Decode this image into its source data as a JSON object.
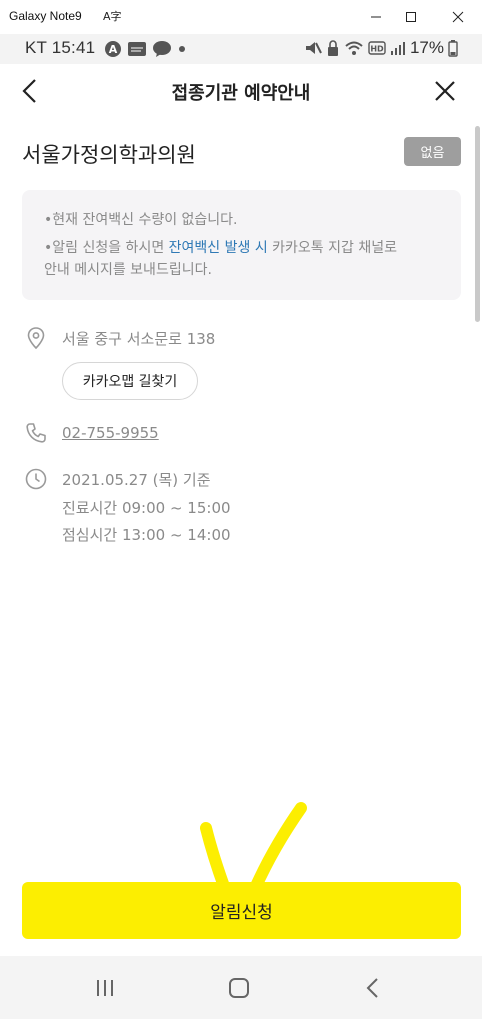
{
  "window": {
    "title": "Galaxy Note9",
    "lang_icon": "A字"
  },
  "status_bar": {
    "carrier_time": "KT 15:41",
    "battery": "17%"
  },
  "header": {
    "title": "접종기관 예약안내"
  },
  "facility": {
    "name": "서울가정의학과의원",
    "badge": "없음"
  },
  "notice": {
    "line1": "•현재 잔여백신 수량이 없습니다.",
    "line2_pre": "•알림 신청을 하시면 ",
    "line2_highlight": "잔여백신 발생 시",
    "line2_post": " 카카오톡 지갑 채널로",
    "line3": "안내 메시지를 보내드립니다."
  },
  "address": {
    "text": "서울 중구 서소문로 138",
    "map_button": "카카오맵 길찾기"
  },
  "phone": {
    "number": "02-755-9955"
  },
  "hours": {
    "date_line": "2021.05.27 (목) 기준",
    "treatment": "진료시간 09:00 ~ 15:00",
    "lunch": "점심시간 13:00 ~ 14:00"
  },
  "cta": {
    "label": "알림신청"
  },
  "colors": {
    "accent": "#fcee01",
    "highlight": "#2f79b5",
    "badge": "#9e9e9e"
  }
}
